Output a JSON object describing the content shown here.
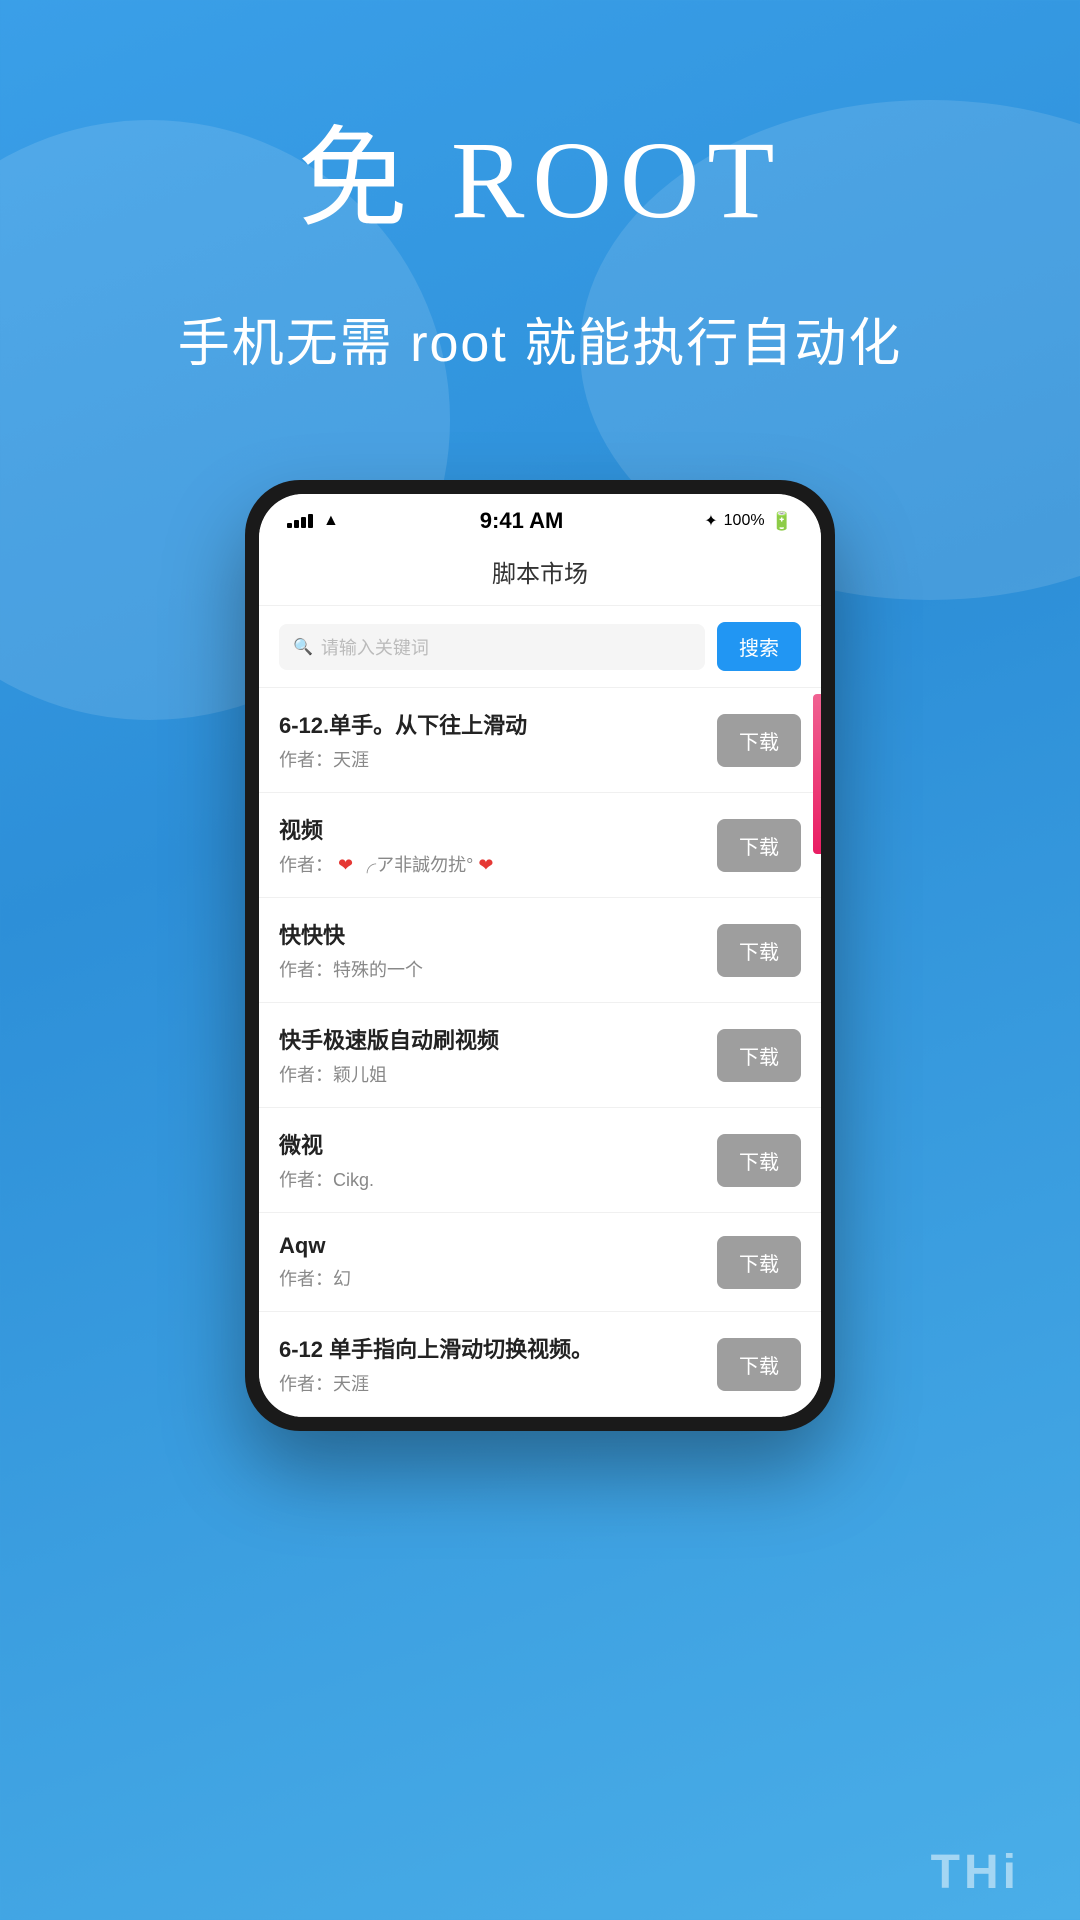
{
  "hero": {
    "title": "免 ROOT",
    "subtitle": "手机无需 root 就能执行自动化"
  },
  "phone": {
    "status_bar": {
      "time": "9:41 AM",
      "battery": "100%",
      "bluetooth": "✦"
    },
    "app_title": "脚本市场",
    "search": {
      "placeholder": "请输入关键词",
      "button_label": "搜索"
    },
    "scripts": [
      {
        "name": "6-12.单手。从下往上滑动",
        "author": "作者：天涯",
        "download_label": "下载"
      },
      {
        "name": "视频",
        "author_prefix": "作者：",
        "author_text": "❤ ╭ア非誠勿扰°❤",
        "download_label": "下载"
      },
      {
        "name": "快快快",
        "author": "作者：特殊的一个",
        "download_label": "下载"
      },
      {
        "name": "快手极速版自动刷视频",
        "author": "作者：颖儿姐",
        "download_label": "下载"
      },
      {
        "name": "微视",
        "author": "作者：Cikg.",
        "download_label": "下载"
      },
      {
        "name": "Aqw",
        "author": "作者：幻",
        "download_label": "下载"
      },
      {
        "name": "6-12 单手指向上滑动切换视频。",
        "author": "作者：天涯",
        "download_label": "下载"
      }
    ]
  },
  "bottom_label": "THi"
}
